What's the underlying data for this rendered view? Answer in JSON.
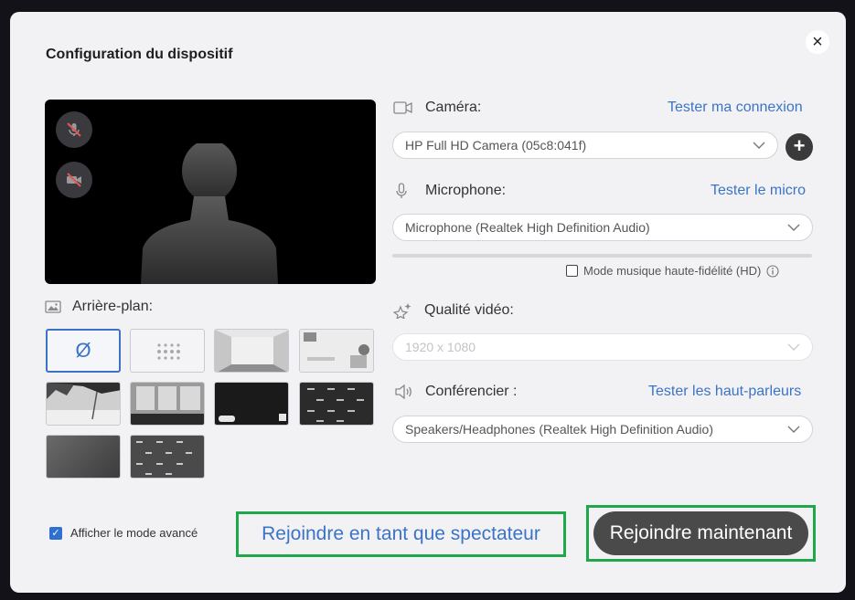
{
  "dialog": {
    "title": "Configuration du dispositif",
    "close_label": "×"
  },
  "background": {
    "label": "Arrière-plan:",
    "none_symbol": "Ø"
  },
  "camera": {
    "label": "Caméra:",
    "link": "Tester ma connexion",
    "value": "HP Full HD Camera (05c8:041f)",
    "add_label": "+"
  },
  "microphone": {
    "label": "Microphone:",
    "link": "Tester le micro",
    "value": "Microphone (Realtek High Definition Audio)",
    "hd_label": "Mode musique haute-fidélité (HD)"
  },
  "video_quality": {
    "label": "Qualité vidéo:",
    "value": "1920 x 1080"
  },
  "speaker": {
    "label": "Conférencier :",
    "link": "Tester les haut-parleurs",
    "value": "Speakers/Headphones (Realtek High Definition Audio)"
  },
  "footer": {
    "advanced_label": "Afficher le mode avancé",
    "spectator_label": "Rejoindre en tant que spectateur",
    "join_label": "Rejoindre maintenant"
  },
  "colors": {
    "accent": "#3b74c6",
    "highlight_border": "#1ea84a",
    "join_button": "#4a4a4a",
    "muted_red": "#e05555"
  }
}
